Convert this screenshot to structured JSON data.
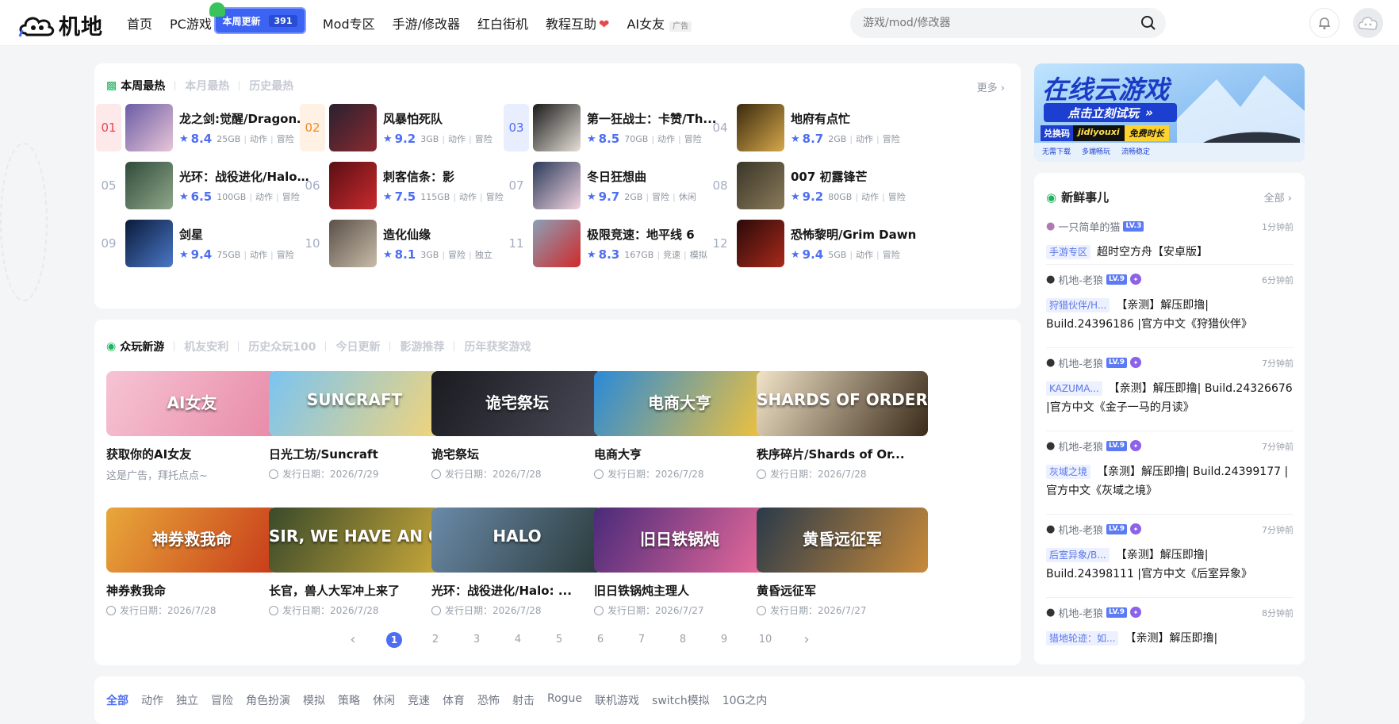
{
  "logo": {
    "text": "机地"
  },
  "nav": {
    "items": [
      "首页",
      "PC游戏",
      "Mod专区",
      "手游/修改器",
      "红白街机",
      "教程互助",
      "AI女友"
    ],
    "weekly_label": "本周更新",
    "weekly_count": "391",
    "ad_label": "广告"
  },
  "search": {
    "placeholder": "游戏/mod/修改器"
  },
  "hot": {
    "tabs": [
      "本周最热",
      "本月最热",
      "历史最热"
    ],
    "more": "更多",
    "items": [
      {
        "rank": "01",
        "title": "龙之剑:觉醒/DragonS...",
        "score": "8.4",
        "size": "25GB",
        "tags": [
          "动作",
          "冒险"
        ]
      },
      {
        "rank": "02",
        "title": "风暴怕死队",
        "score": "9.2",
        "size": "3GB",
        "tags": [
          "动作",
          "冒险"
        ]
      },
      {
        "rank": "03",
        "title": "第一狂战士：卡赞/Th...",
        "score": "8.5",
        "size": "70GB",
        "tags": [
          "动作",
          "冒险"
        ]
      },
      {
        "rank": "04",
        "title": "地府有点忙",
        "score": "8.7",
        "size": "2GB",
        "tags": [
          "动作",
          "冒险"
        ]
      },
      {
        "rank": "05",
        "title": "光环：战役进化/Halo:...",
        "score": "6.5",
        "size": "100GB",
        "tags": [
          "动作",
          "冒险"
        ]
      },
      {
        "rank": "06",
        "title": "刺客信条：影",
        "score": "7.5",
        "size": "115GB",
        "tags": [
          "动作",
          "冒险"
        ]
      },
      {
        "rank": "07",
        "title": "冬日狂想曲",
        "score": "9.7",
        "size": "2GB",
        "tags": [
          "冒险",
          "休闲"
        ]
      },
      {
        "rank": "08",
        "title": "007 初露锋芒",
        "score": "9.2",
        "size": "80GB",
        "tags": [
          "动作",
          "冒险"
        ]
      },
      {
        "rank": "09",
        "title": "剑星",
        "score": "9.4",
        "size": "75GB",
        "tags": [
          "动作",
          "冒险"
        ]
      },
      {
        "rank": "10",
        "title": "造化仙缘",
        "score": "8.1",
        "size": "3GB",
        "tags": [
          "冒险",
          "独立"
        ]
      },
      {
        "rank": "11",
        "title": "极限竞速：地平线 6",
        "score": "8.3",
        "size": "167GB",
        "tags": [
          "竞速",
          "模拟"
        ]
      },
      {
        "rank": "12",
        "title": "恐怖黎明/Grim Dawn",
        "score": "9.4",
        "size": "5GB",
        "tags": [
          "动作",
          "冒险"
        ]
      }
    ]
  },
  "newgames": {
    "tabs": [
      "众玩新游",
      "机友安利",
      "历史众玩100",
      "今日更新",
      "影游推荐",
      "历年获奖游戏"
    ],
    "games": [
      {
        "title": "获取你的AI女友",
        "date": "这是广告，拜托点点~",
        "cover": "AI女友",
        "ad": true
      },
      {
        "title": "日光工坊/Suncraft",
        "date": "发行日期：2026/7/29",
        "cover": "SUNCRAFT"
      },
      {
        "title": "诡宅祭坛",
        "date": "发行日期：2026/7/28",
        "cover": "诡宅祭坛"
      },
      {
        "title": "电商大亨",
        "date": "发行日期：2026/7/28",
        "cover": "电商大亨"
      },
      {
        "title": "秩序碎片/Shards of Or...",
        "date": "发行日期：2026/7/28",
        "cover": "SHARDS OF ORDER"
      },
      {
        "title": "神券救我命",
        "date": "发行日期：2026/7/28",
        "cover": "神券救我命"
      },
      {
        "title": "长官，兽人大军冲上来了",
        "date": "发行日期：2026/7/28",
        "cover": "SIR, WE HAVE AN ORC PROBLEM"
      },
      {
        "title": "光环：战役进化/Halo: ...",
        "date": "发行日期：2026/7/28",
        "cover": "HALO"
      },
      {
        "title": "旧日铁锅炖主理人",
        "date": "发行日期：2026/7/27",
        "cover": "旧日铁锅炖"
      },
      {
        "title": "黄昏远征军",
        "date": "发行日期：2026/7/27",
        "cover": "黄昏远征军"
      }
    ],
    "pages": [
      "1",
      "2",
      "3",
      "4",
      "5",
      "6",
      "7",
      "8",
      "9",
      "10"
    ]
  },
  "banner": {
    "title": "在线云游戏",
    "cta": "点击立刻试玩",
    "code_label": "兑换码",
    "code": "jidiyouxi",
    "free": "免费时长",
    "features": [
      "无需下载",
      "多端畅玩",
      "流畅稳定"
    ]
  },
  "news": {
    "title": "新鲜事儿",
    "all": "全部",
    "items": [
      {
        "user": "一只简单的猫",
        "level": "LV.3",
        "time": "1分钟前",
        "tag": "手游专区",
        "text": "超时空方舟【安卓版】",
        "verified": false
      },
      {
        "user": "机地-老狼",
        "level": "LV.9",
        "time": "6分钟前",
        "tag": "狩猎伙伴/H...",
        "text": "【亲测】解压即撸| Build.24396186 |官方中文《狩猎伙伴》",
        "verified": true
      },
      {
        "user": "机地-老狼",
        "level": "LV.9",
        "time": "7分钟前",
        "tag": "KAZUMA...",
        "text": "【亲测】解压即撸| Build.24326676 |官方中文《金子一马的月读》",
        "verified": true
      },
      {
        "user": "机地-老狼",
        "level": "LV.9",
        "time": "7分钟前",
        "tag": "灰域之境",
        "text": "【亲测】解压即撸| Build.24399177 |官方中文《灰域之境》",
        "verified": true
      },
      {
        "user": "机地-老狼",
        "level": "LV.9",
        "time": "7分钟前",
        "tag": "后室异象/B...",
        "text": "【亲测】解压即撸| Build.24398111 |官方中文《后室异象》",
        "verified": true
      },
      {
        "user": "机地-老狼",
        "level": "LV.9",
        "time": "8分钟前",
        "tag": "猎地轮迹：如...",
        "text": "【亲测】解压即撸|",
        "verified": true
      }
    ]
  },
  "categories": [
    "全部",
    "动作",
    "独立",
    "冒险",
    "角色扮演",
    "模拟",
    "策略",
    "休闲",
    "竞速",
    "体育",
    "恐怖",
    "射击",
    "Rogue",
    "联机游戏",
    "switch模拟",
    "10G之内"
  ],
  "colors": {
    "accent": "#4e6ef2",
    "rank_top1": "#e5484d",
    "rank_top2": "#f08a2a",
    "rank_top3": "#4e6ef2"
  }
}
